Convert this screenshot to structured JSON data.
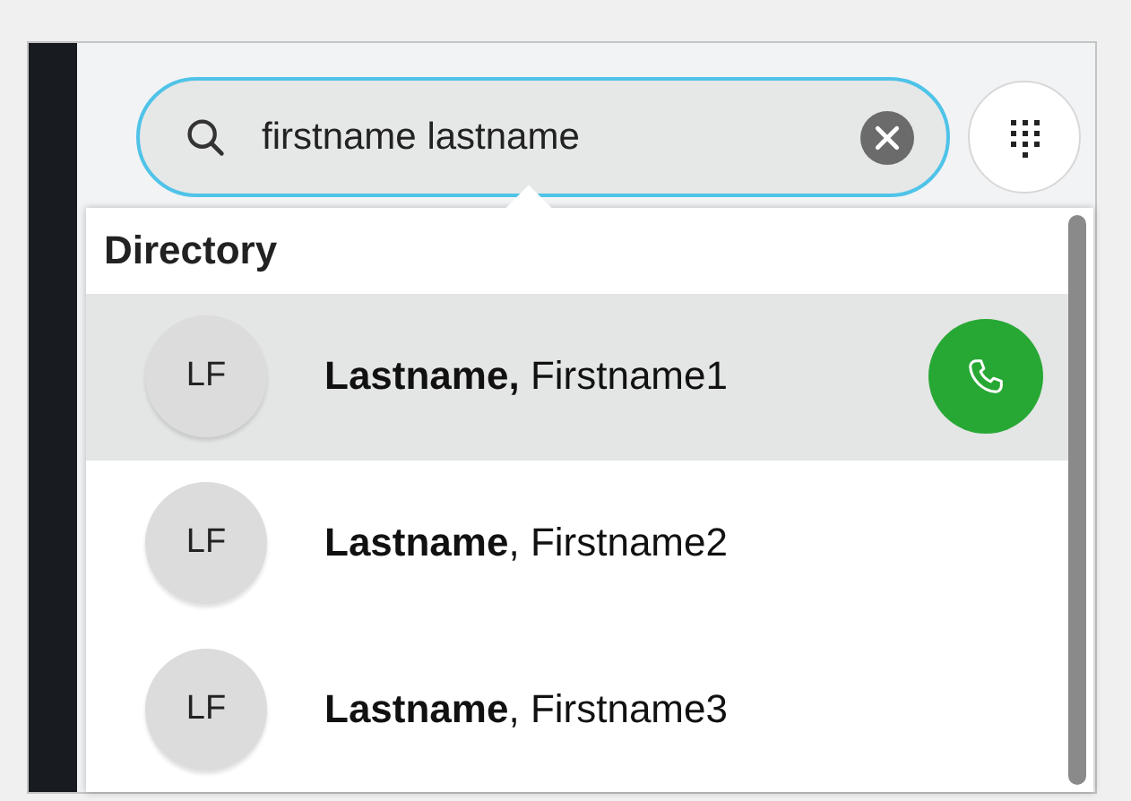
{
  "search": {
    "value": "firstname lastname",
    "focused": true
  },
  "directory": {
    "heading": "Directory",
    "results": [
      {
        "initials": "LF",
        "name": "**Lastname,** Firstname1",
        "selected": true
      },
      {
        "initials": "LF",
        "name": "**Lastname**, Firstname2",
        "selected": false
      },
      {
        "initials": "LF",
        "name": "**Lastname**, Firstname3",
        "selected": false
      }
    ]
  }
}
